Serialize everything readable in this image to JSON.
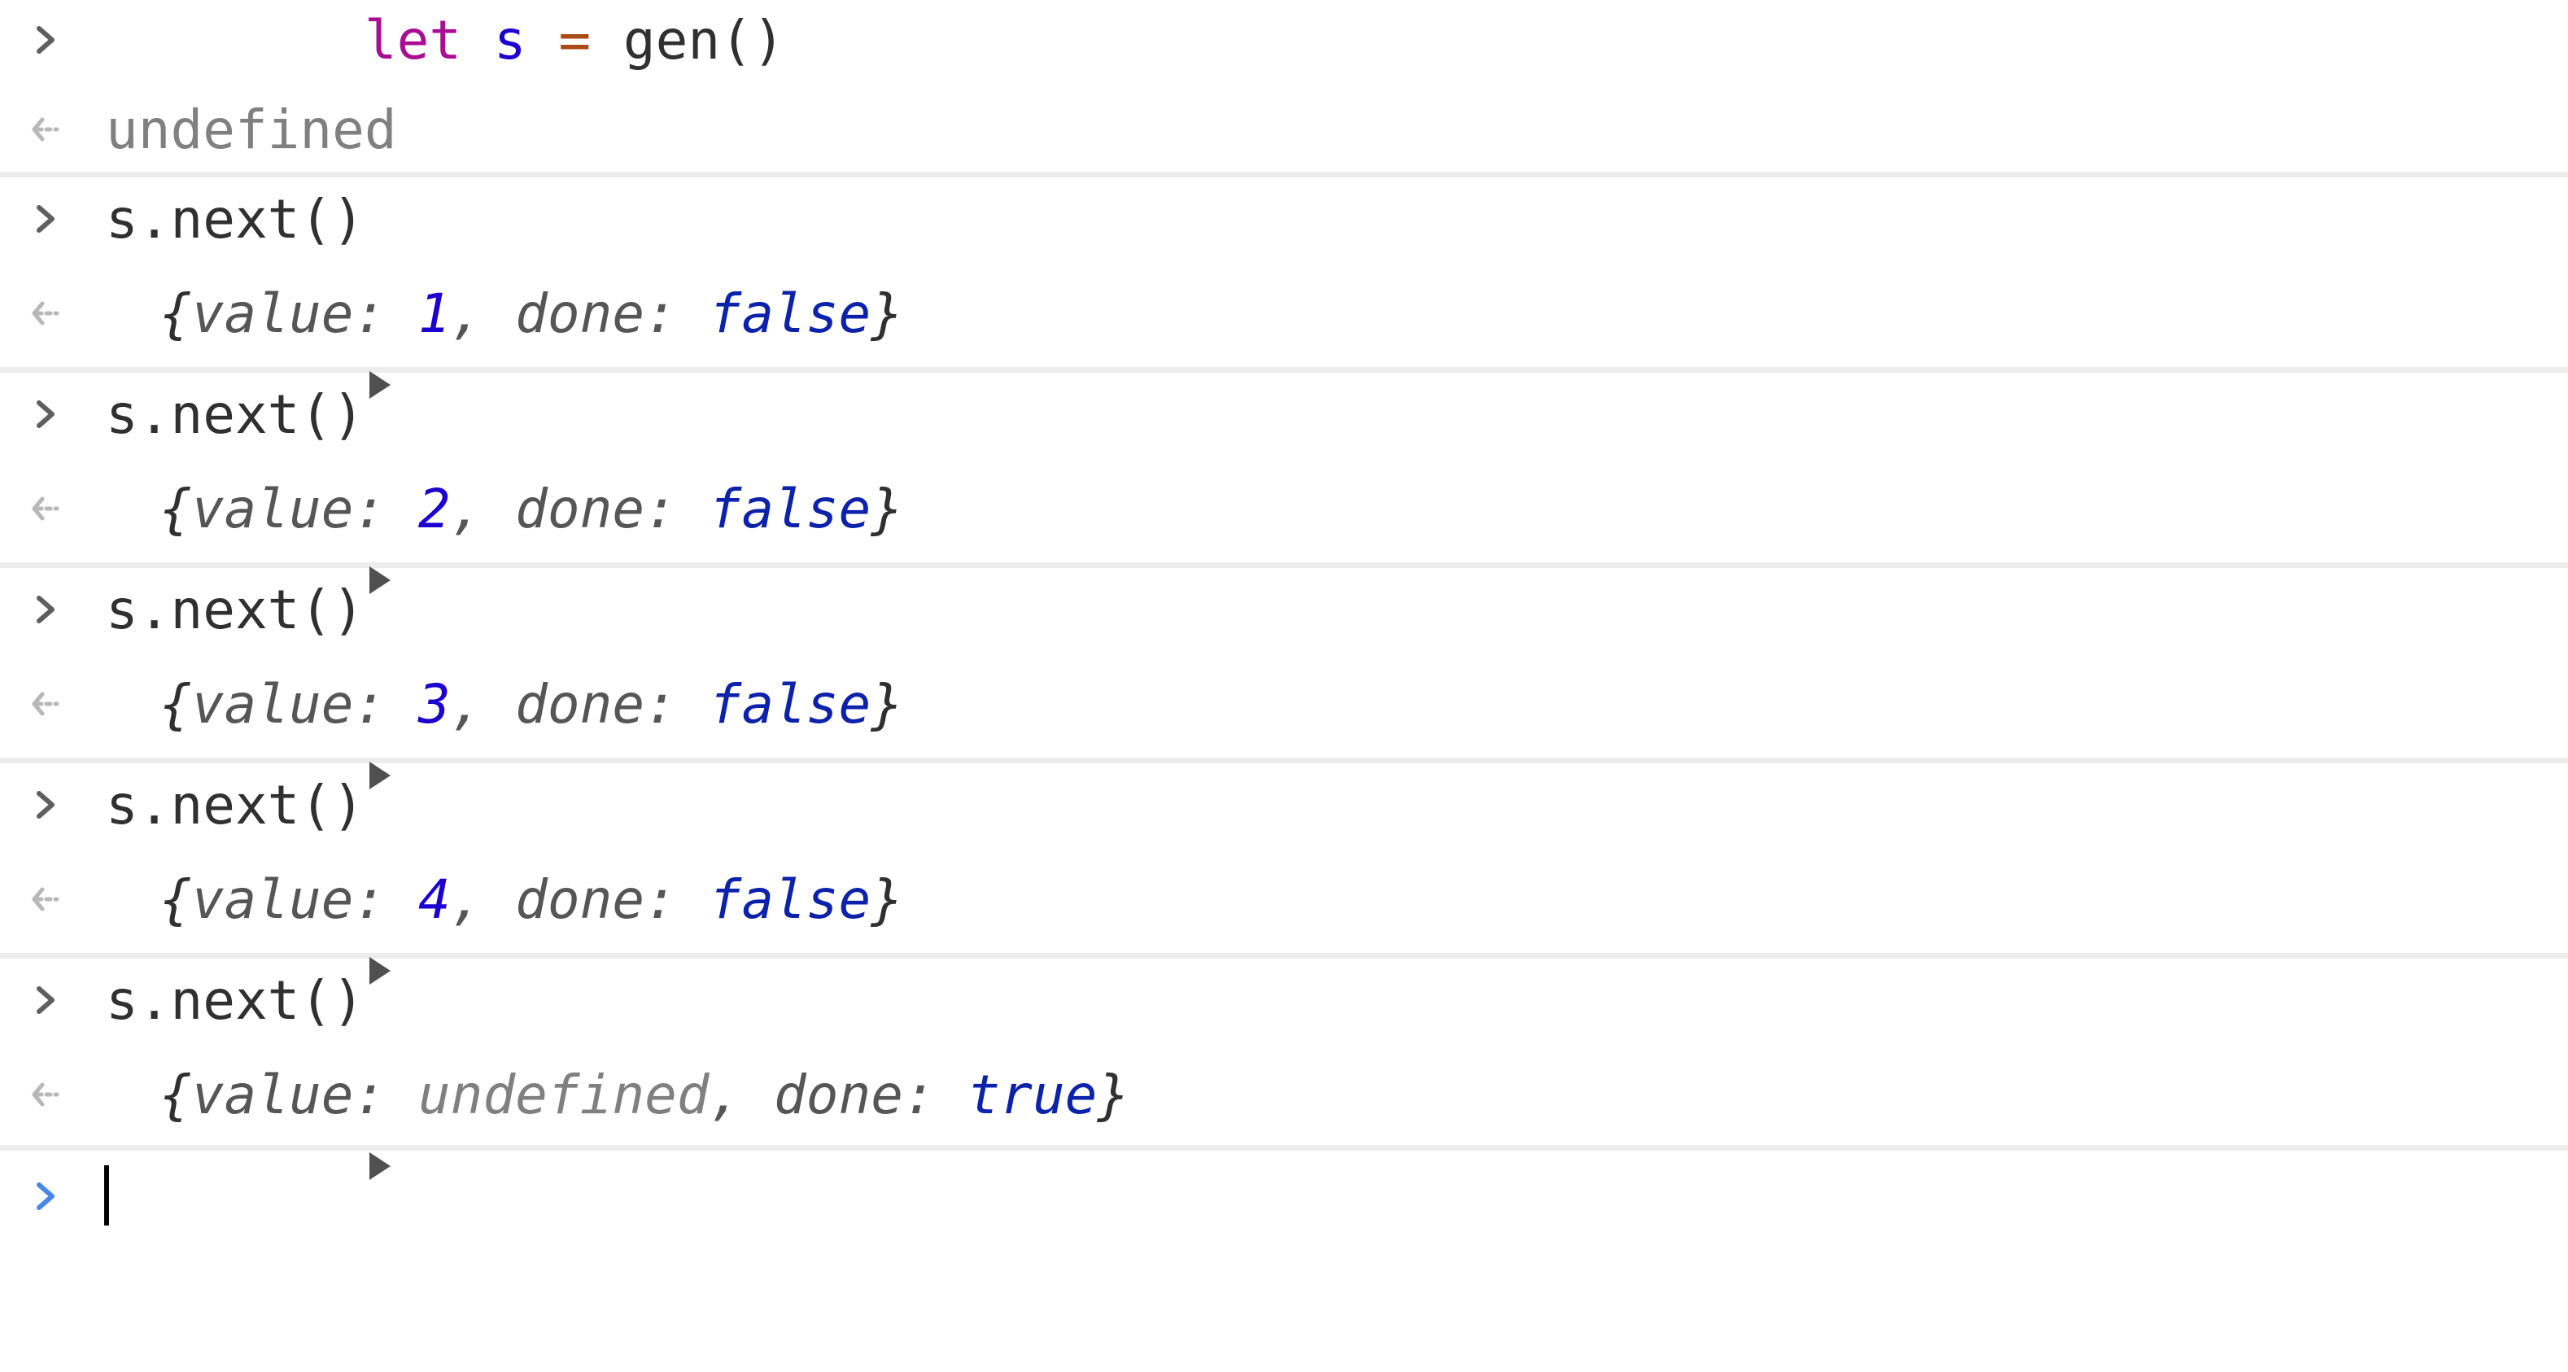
{
  "console": {
    "entries": [
      {
        "input": {
          "tokens": [
            {
              "t": "let",
              "c": "kw"
            },
            {
              "t": " ",
              "c": "plain"
            },
            {
              "t": "s",
              "c": "var"
            },
            {
              "t": " ",
              "c": "plain"
            },
            {
              "t": "=",
              "c": "op"
            },
            {
              "t": " gen()",
              "c": "plain"
            }
          ]
        },
        "output": {
          "kind": "primitive",
          "text": "undefined"
        }
      },
      {
        "input": {
          "text": "s.next()"
        },
        "output": {
          "kind": "object",
          "value": "1",
          "value_kind": "num",
          "done": "false"
        }
      },
      {
        "input": {
          "text": "s.next()"
        },
        "output": {
          "kind": "object",
          "value": "2",
          "value_kind": "num",
          "done": "false"
        }
      },
      {
        "input": {
          "text": "s.next()"
        },
        "output": {
          "kind": "object",
          "value": "3",
          "value_kind": "num",
          "done": "false"
        }
      },
      {
        "input": {
          "text": "s.next()"
        },
        "output": {
          "kind": "object",
          "value": "4",
          "value_kind": "num",
          "done": "false"
        }
      },
      {
        "input": {
          "text": "s.next()"
        },
        "output": {
          "kind": "object",
          "value": "undefined",
          "value_kind": "undef",
          "done": "true"
        }
      }
    ],
    "labels": {
      "open_brace": "{",
      "close_brace": "}",
      "value_key": "value",
      "done_key": "done",
      "colon": ": ",
      "comma": ", "
    },
    "icons": {
      "prompt": "chevron-right-icon",
      "result": "result-arrow-icon",
      "expand": "disclosure-triangle-icon"
    },
    "colors": {
      "keyword": "#aa0d91",
      "variable": "#1c00cf",
      "operator": "#aa4a14",
      "number": "#1c00cf",
      "boolean": "#0d22aa",
      "undefined": "#808080",
      "active_prompt": "#4a86e8",
      "separator": "#ececec"
    }
  }
}
